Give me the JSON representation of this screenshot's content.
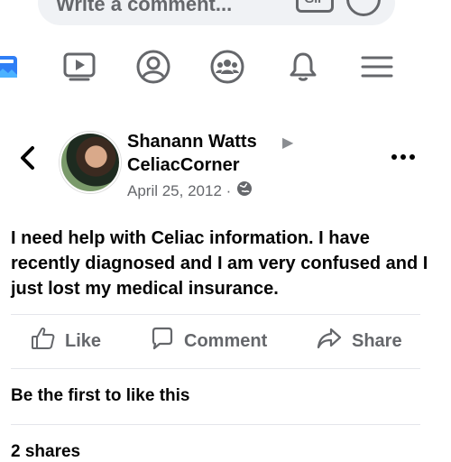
{
  "comment_bar": {
    "placeholder": "Write a comment...",
    "gif_label": "GIF"
  },
  "nav": {
    "icons": [
      "image-icon",
      "video-icon",
      "profile-icon",
      "groups-icon",
      "bell-icon",
      "menu-icon"
    ]
  },
  "post": {
    "author": "Shanann Watts",
    "group": "CeliacCorner",
    "date": "April 25, 2012 ·",
    "audience_icon": "globe-icon",
    "text": "I need help with Celiac information. I have recently diagnosed and I am very confused and I just lost my medical insurance."
  },
  "actions": {
    "like": "Like",
    "comment": "Comment",
    "share": "Share"
  },
  "footer": {
    "likes_text": "Be the first to like this",
    "shares_text": "2 shares"
  },
  "colors": {
    "icon_gray": "#65676b",
    "text": "#050505",
    "divider": "#e4e6eb",
    "bar_bg": "#f0f2f5",
    "blue_accent": "#1877f2"
  }
}
